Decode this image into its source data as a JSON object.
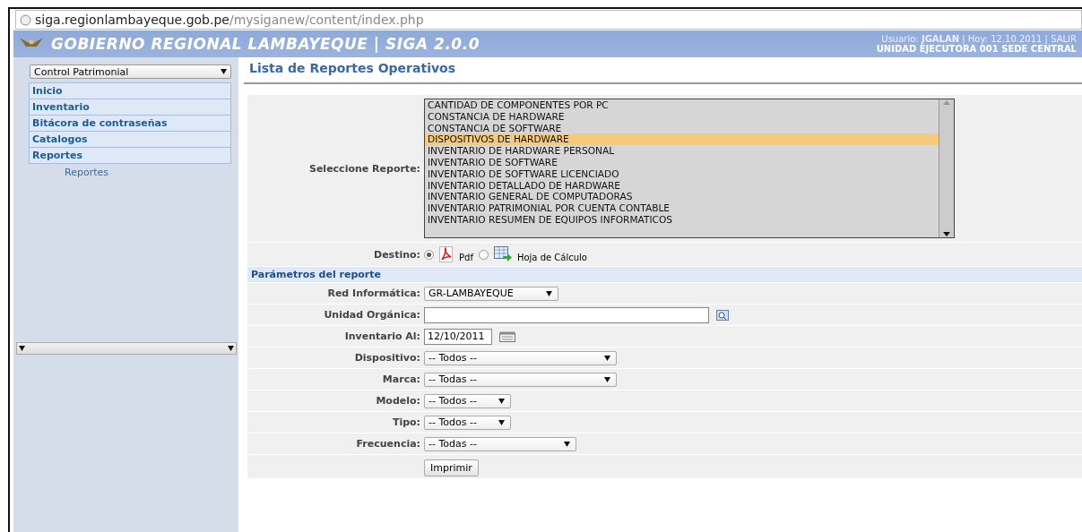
{
  "address_bar": {
    "host": "siga.regionlambayeque.gob.pe",
    "path": "/mysiganew/content/index.php"
  },
  "header": {
    "title": "GOBIERNO REGIONAL LAMBAYEQUE | SIGA 2.0.0",
    "user_line": "Usuario: **JGALAN** | Hoy: 12.10.2011 | SALIR",
    "unit": "UNIDAD EJECUTORA 001 SEDE CENTRAL"
  },
  "sidebar": {
    "module": "Control Patrimonial",
    "items": [
      {
        "label": "Inicio"
      },
      {
        "label": "Inventario"
      },
      {
        "label": "Bitácora de contraseñas"
      },
      {
        "label": "Catalogos"
      },
      {
        "label": "Reportes",
        "children": [
          {
            "label": "Reportes"
          }
        ]
      }
    ]
  },
  "page_title": "Lista de Reportes Operativos",
  "report_select": {
    "label": "Seleccione Reporte:",
    "options": [
      {
        "label": "CANTIDAD DE COMPONENTES POR PC",
        "selected": false
      },
      {
        "label": "CONSTANCIA DE HARDWARE",
        "selected": false
      },
      {
        "label": "CONSTANCIA DE SOFTWARE",
        "selected": false
      },
      {
        "label": "DISPOSITIVOS DE HARDWARE",
        "selected": true
      },
      {
        "label": "INVENTARIO DE HARDWARE PERSONAL",
        "selected": false
      },
      {
        "label": "INVENTARIO DE SOFTWARE",
        "selected": false
      },
      {
        "label": "INVENTARIO DE SOFTWARE LICENCIADO",
        "selected": false
      },
      {
        "label": "INVENTARIO DETALLADO DE HARDWARE",
        "selected": false
      },
      {
        "label": "INVENTARIO GENERAL DE COMPUTADORAS",
        "selected": false
      },
      {
        "label": "INVENTARIO PATRIMONIAL POR CUENTA CONTABLE",
        "selected": false
      },
      {
        "label": "INVENTARIO RESUMEN DE EQUIPOS INFORMATICOS",
        "selected": false
      }
    ]
  },
  "destination": {
    "label": "Destino:",
    "options": [
      {
        "label": "Pdf",
        "kind": "pdf",
        "selected": true
      },
      {
        "label": "Hoja de Cálculo",
        "kind": "sheet",
        "selected": false
      }
    ]
  },
  "parameters": {
    "title": "Parámetros del reporte",
    "fields": [
      {
        "label": "Red Informática:",
        "kind": "select",
        "value": "GR-LAMBAYEQUE"
      },
      {
        "label": "Unidad Orgánica:",
        "kind": "lookup"
      },
      {
        "label": "Inventario Al:",
        "kind": "date",
        "value": "12/10/2011"
      },
      {
        "label": "Dispositivo:",
        "kind": "select",
        "value": "-- Todos --"
      },
      {
        "label": "Marca:",
        "kind": "select",
        "value": "-- Todas --"
      },
      {
        "label": "Modelo:",
        "kind": "select",
        "value": "-- Todos --"
      },
      {
        "label": "Tipo:",
        "kind": "select",
        "value": "-- Todos --"
      },
      {
        "label": "Frecuencia:",
        "kind": "select",
        "value": "-- Todas --"
      }
    ]
  },
  "print_button": "Imprimir"
}
